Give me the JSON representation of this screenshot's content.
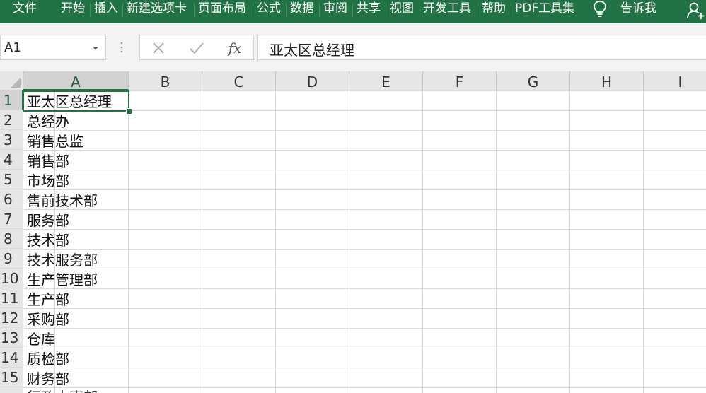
{
  "ribbon": {
    "tabs": [
      "文件",
      "开始",
      "插入",
      "新建选项卡",
      "页面布局",
      "公式",
      "数据",
      "审阅",
      "共享",
      "视图",
      "开发工具",
      "帮助",
      "PDF工具集"
    ],
    "tell_me": "告诉我",
    "colors": {
      "ribbon_bg": "#217346",
      "accent": "#217346"
    }
  },
  "formula_bar": {
    "name_box": "A1",
    "cancel_icon": "cross-icon",
    "enter_icon": "check-icon",
    "fx_label": "fx",
    "content": "亚太区总经理"
  },
  "grid": {
    "columns": [
      "A",
      "B",
      "C",
      "D",
      "E",
      "F",
      "G",
      "H",
      "I"
    ],
    "selected_column": "A",
    "rows": [
      "1",
      "2",
      "3",
      "4",
      "5",
      "6",
      "7",
      "8",
      "9",
      "10",
      "11",
      "12",
      "13",
      "14",
      "15"
    ],
    "selected_row": "1",
    "column_a": [
      "亚太区总经理",
      "总经办",
      "销售总监",
      "销售部",
      "市场部",
      "售前技术部",
      "服务部",
      "技术部",
      "技术服务部",
      "生产管理部",
      "生产部",
      "采购部",
      "仓库",
      "质检部",
      "财务部"
    ],
    "partial_row_16": "行政人事部"
  }
}
